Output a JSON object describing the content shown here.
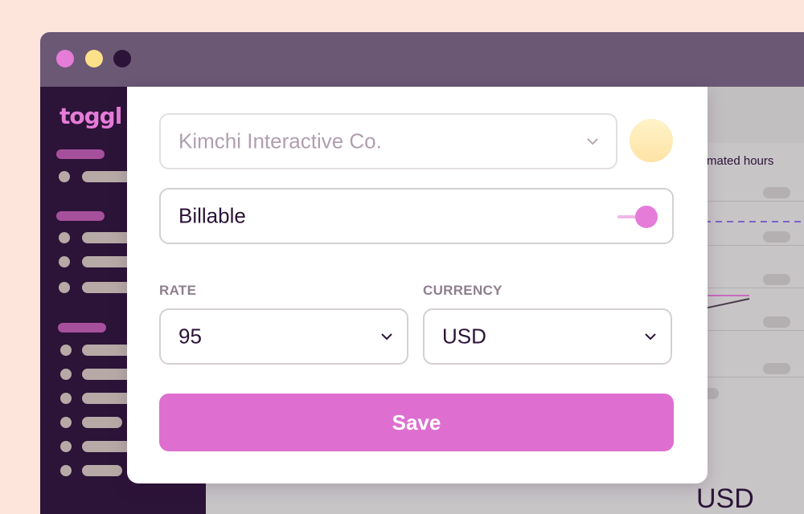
{
  "colors": {
    "page_background": "#fde5dc",
    "titlebar": "#6b5875",
    "sidebar": "#2c1338",
    "brand_pink": "#e57cd8",
    "save_button": "#de6fd0",
    "dot_close": "#e57cd8",
    "dot_minimize": "#fde08a",
    "dot_maximize": "#2c1338"
  },
  "app": {
    "logo_text": "toggl t"
  },
  "background_view": {
    "estimated_hours_label": "stimated hours",
    "currency_readout": "USD"
  },
  "project_form": {
    "client_select": {
      "value": "Kimchi Interactive Co.",
      "icon": "chevron-down-icon"
    },
    "color_picker": {
      "color": "#fde8b0"
    },
    "billable": {
      "label": "Billable",
      "enabled": true
    },
    "rate": {
      "label": "RATE",
      "value": "95",
      "icon": "chevron-down-icon"
    },
    "currency": {
      "label": "CURRENCY",
      "value": "USD",
      "icon": "chevron-down-icon"
    },
    "save_label": "Save"
  }
}
